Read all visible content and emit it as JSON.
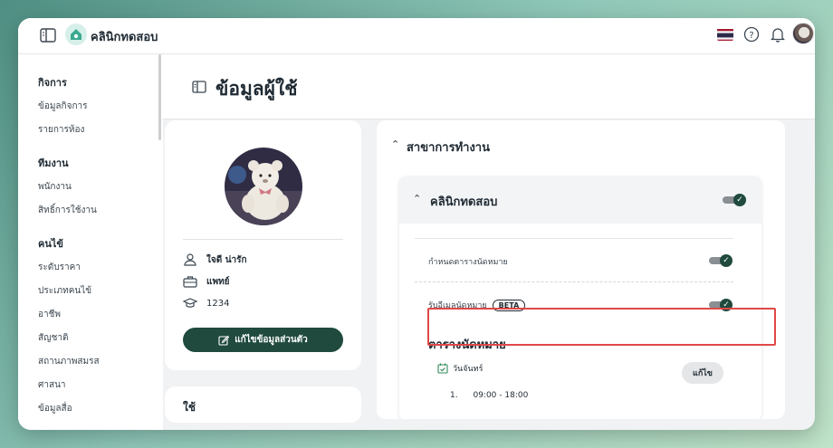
{
  "app": {
    "name": "คลินิกทดสอบ"
  },
  "sidebar": {
    "groups": [
      {
        "heading": "กิจการ",
        "items": [
          "ข้อมูลกิจการ",
          "รายการห้อง"
        ]
      },
      {
        "heading": "ทีมงาน",
        "items": [
          "พนักงาน",
          "สิทธิ์การใช้งาน"
        ]
      },
      {
        "heading": "คนไข้",
        "items": [
          "ระดับราคา",
          "ประเภทคนไข้",
          "อาชีพ",
          "สัญชาติ",
          "สถานภาพสมรส",
          "ศาสนา",
          "ข้อมูลสื่อ"
        ]
      }
    ]
  },
  "page": {
    "title": "ข้อมูลผู้ใช้"
  },
  "profile": {
    "name": "ใจดี น่ารัก",
    "role": "แพทย์",
    "code": "1234",
    "edit_button": "แก้ไขข้อมูลส่วนตัว",
    "next_card_partial": "ใช้"
  },
  "branches": {
    "section_title": "สาขาการทำงาน",
    "clinic_name": "คลินิกทดสอบ",
    "settings": [
      {
        "label": "กำหนดตารางนัดหมาย",
        "enabled": true
      },
      {
        "label": "รับอีเมลนัดหมาย",
        "badge": "BETA",
        "enabled": true
      }
    ],
    "schedule_title": "ตารางนัดหมาย",
    "day": "วันจันทร์",
    "edit_button": "แก้ไข",
    "slots": [
      {
        "index": "1.",
        "time": "09:00 - 18:00"
      }
    ]
  },
  "colors": {
    "primary": "#1f4a3d",
    "highlight": "#e04848"
  }
}
